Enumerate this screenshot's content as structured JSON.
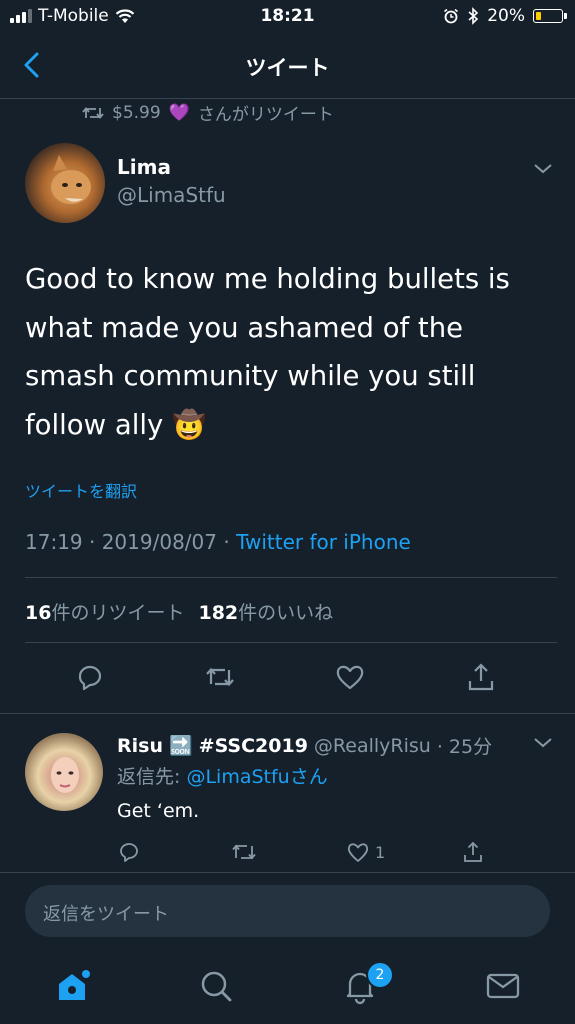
{
  "status_bar": {
    "carrier": "T-Mobile",
    "time": "18:21",
    "battery": "20%",
    "battery_level": 0.2,
    "icons": [
      "signal-icon",
      "wifi-icon",
      "alarm-icon",
      "bluetooth-icon",
      "battery-icon"
    ]
  },
  "nav": {
    "title": "ツイート",
    "back_icon": "chevron-left-icon"
  },
  "retweet_notice": {
    "prefix": "$5.99",
    "emoji": "💜",
    "suffix": "さんがリツイート"
  },
  "tweet": {
    "author_name": "Lima",
    "author_handle": "@LimaStfu",
    "text": "Good to know me holding bullets is what made you ashamed of the smash community while you still follow ally 🤠",
    "translate_label": "ツイートを翻訳",
    "timestamp": "17:19 · 2019/08/07 · ",
    "source": "Twitter for iPhone",
    "retweet_count": "16",
    "retweet_label": "件のリツイート",
    "like_count": "182",
    "like_label": "件のいいね"
  },
  "reply": {
    "author_name": "Risu",
    "emoji": "🔜",
    "hashtag": "#SSC2019",
    "handle": "@ReallyRisu",
    "time": "· 25分",
    "reply_to_label": "返信先: ",
    "reply_to_handle": "@LimaStfu",
    "reply_to_suffix": "さん",
    "text": "Get ‘em.",
    "like_count": "1"
  },
  "reply_input": {
    "placeholder": "返信をツイート"
  },
  "tab_bar": {
    "notification_badge": "2"
  },
  "colors": {
    "background": "#15202b",
    "accent": "#1da1f2",
    "muted": "#8899a6",
    "divider": "#38444d"
  }
}
